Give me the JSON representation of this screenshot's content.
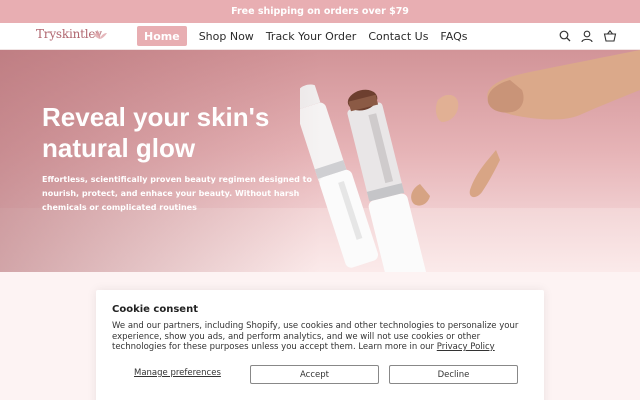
{
  "announcement": "Free shipping on orders over $79",
  "header": {
    "logo": "Tryskintlev",
    "nav": [
      "Home",
      "Shop Now",
      "Track Your Order",
      "Contact Us",
      "FAQs"
    ],
    "icons": [
      "search-icon",
      "account-icon",
      "cart-icon"
    ]
  },
  "hero": {
    "title": "Reveal your skin's natural glow",
    "subtitle": "Effortless, scientifically proven beauty regimen designed to nourish, protect, and enhace your beauty. Without harsh chemicals or complicated routines"
  },
  "cookie": {
    "title": "Cookie consent",
    "text": "We and our partners, including Shopify, use cookies and other technologies to personalize your experience, show you ads, and perform analytics, and we will not use cookies or other technologies for these purposes unless you accept them. Learn more in our",
    "link": "Privacy Policy",
    "manage": "Manage preferences",
    "accept": "Accept",
    "decline": "Decline"
  },
  "colors": {
    "accent": "#e8aeb2",
    "logo": "#b0666f"
  }
}
